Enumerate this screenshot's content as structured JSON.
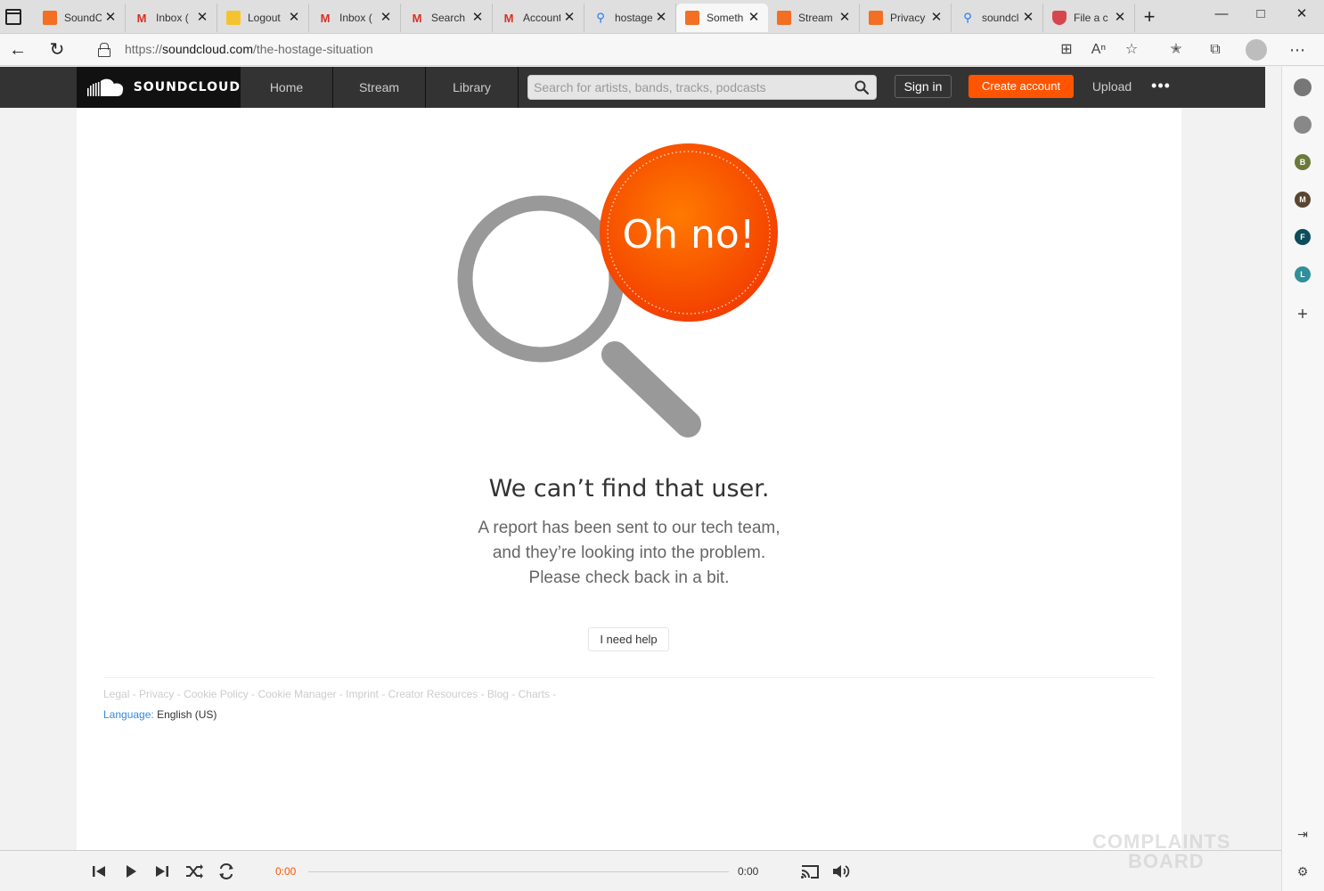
{
  "browser": {
    "tabs": [
      {
        "label": "SoundCloud",
        "favicon": "soundcloud-icon",
        "active": false
      },
      {
        "label": "Inbox (",
        "favicon": "gmail-icon",
        "active": false
      },
      {
        "label": "Logout",
        "favicon": "logout-icon",
        "active": false
      },
      {
        "label": "Inbox (",
        "favicon": "gmail-icon",
        "active": false
      },
      {
        "label": "Search",
        "favicon": "gmail-icon",
        "active": false
      },
      {
        "label": "Account",
        "favicon": "gmail-icon",
        "active": false
      },
      {
        "label": "hostage",
        "favicon": "search-icon",
        "active": false
      },
      {
        "label": "Something",
        "favicon": "soundcloud-icon",
        "active": true
      },
      {
        "label": "Stream",
        "favicon": "soundcloud-icon",
        "active": false
      },
      {
        "label": "Privacy",
        "favicon": "soundcloud-icon",
        "active": false
      },
      {
        "label": "soundcloud",
        "favicon": "search-icon",
        "active": false
      },
      {
        "label": "File a c",
        "favicon": "shield-icon",
        "active": false
      }
    ],
    "url_prefix": "https://",
    "url_host": "soundcloud.com",
    "url_path": "/the-hostage-situation"
  },
  "sidebar": {
    "letters": [
      "B",
      "M",
      "F",
      "L"
    ],
    "letter_colors": [
      "#6b7a3a",
      "#5a4630",
      "#0d4c5a",
      "#2f8f9a"
    ]
  },
  "soundcloud": {
    "logo_text": "SOUNDCLOUD",
    "nav": [
      "Home",
      "Stream",
      "Library"
    ],
    "search_placeholder": "Search for artists, bands, tracks, podcasts",
    "sign_in": "Sign in",
    "create_account": "Create account",
    "upload": "Upload",
    "more": "•••",
    "accent": "#ff5500"
  },
  "error": {
    "badge": "Oh no!",
    "title": "We can’t find that user.",
    "lines": [
      "A report has been sent to our tech team,",
      "and they’re looking into the problem.",
      "Please check back in a bit."
    ],
    "help_button": "I need help"
  },
  "footer": {
    "links": [
      "Legal",
      "Privacy",
      "Cookie Policy",
      "Cookie Manager",
      "Imprint",
      "Creator Resources",
      "Blog",
      "Charts"
    ],
    "separator": " - ",
    "language_label": "Language:",
    "language_value": "English (US)"
  },
  "player": {
    "current_time": "0:00",
    "total_time": "0:00",
    "progress": 0
  },
  "watermark": {
    "line1": "COMPLAINTS",
    "line2": "BOARD"
  }
}
